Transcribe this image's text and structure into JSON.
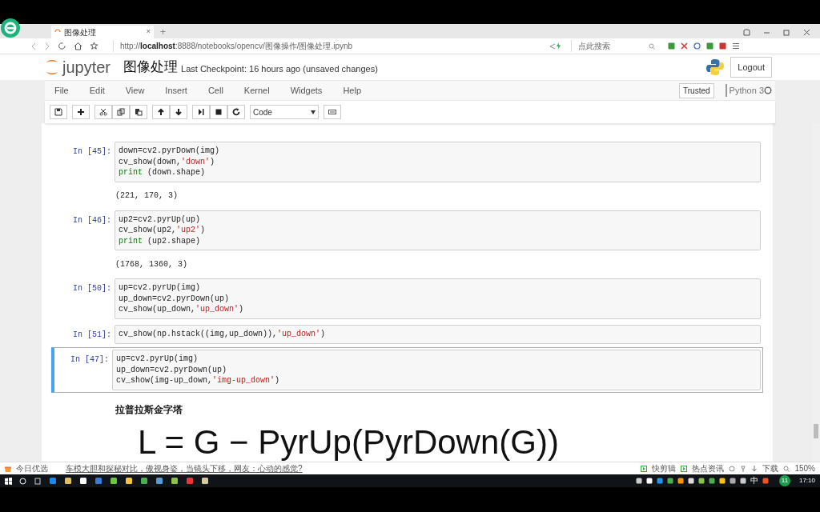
{
  "browser": {
    "tab_title": "图像处理",
    "tab_close": "×",
    "new_tab": "+",
    "url_prefix": "http://",
    "url_host": "localhost",
    "url_rest": ":8888/notebooks/opencv/图像操作/图像处理.ipynb",
    "search_placeholder": "点此搜索"
  },
  "jupyter": {
    "logo_text": "jupyter",
    "notebook_name": "图像处理",
    "checkpoint": "Last Checkpoint: 16 hours ago (unsaved changes)",
    "logout": "Logout",
    "menu": [
      "File",
      "Edit",
      "View",
      "Insert",
      "Cell",
      "Kernel",
      "Widgets",
      "Help"
    ],
    "trusted": "Trusted",
    "kernel": "Python 3",
    "cell_type": "Code"
  },
  "cells": [
    {
      "kind": "code",
      "prompt": "In [45]:",
      "selected": false,
      "lines": [
        [
          {
            "text": "down=cv2.pyrDown(img)",
            "kind": "plain"
          }
        ],
        [
          {
            "text": "cv_show(down,",
            "kind": "plain"
          },
          {
            "text": "'down'",
            "kind": "string"
          },
          {
            "text": ")",
            "kind": "plain"
          }
        ],
        [
          {
            "text": "print",
            "kind": "builtin"
          },
          {
            "text": " (down.shape)",
            "kind": "plain"
          }
        ]
      ]
    },
    {
      "kind": "output",
      "text": "(221, 170, 3)"
    },
    {
      "kind": "code",
      "prompt": "In [46]:",
      "selected": false,
      "lines": [
        [
          {
            "text": "up2=cv2.pyrUp(up)",
            "kind": "plain"
          }
        ],
        [
          {
            "text": "cv_show(up2,",
            "kind": "plain"
          },
          {
            "text": "'up2'",
            "kind": "string"
          },
          {
            "text": ")",
            "kind": "plain"
          }
        ],
        [
          {
            "text": "print",
            "kind": "builtin"
          },
          {
            "text": " (up2.shape)",
            "kind": "plain"
          }
        ]
      ]
    },
    {
      "kind": "output",
      "text": "(1768, 1360, 3)"
    },
    {
      "kind": "code",
      "prompt": "In [50]:",
      "selected": false,
      "lines": [
        [
          {
            "text": "up=cv2.pyrUp(img)",
            "kind": "plain"
          }
        ],
        [
          {
            "text": "up_down=cv2.pyrDown(up)",
            "kind": "plain"
          }
        ],
        [
          {
            "text": "cv_show(up_down,",
            "kind": "plain"
          },
          {
            "text": "'up_down'",
            "kind": "string"
          },
          {
            "text": ")",
            "kind": "plain"
          }
        ]
      ]
    },
    {
      "kind": "code",
      "prompt": "In [51]:",
      "selected": false,
      "lines": [
        [
          {
            "text": "cv_show(np.hstack((img,up_down)),",
            "kind": "plain"
          },
          {
            "text": "'up_down'",
            "kind": "string"
          },
          {
            "text": ")",
            "kind": "plain"
          }
        ]
      ]
    },
    {
      "kind": "code",
      "prompt": "In [47]:",
      "selected": true,
      "lines": [
        [
          {
            "text": "up=cv2.pyrUp(img)",
            "kind": "plain"
          }
        ],
        [
          {
            "text": "up_down=cv2.pyrDown(up)",
            "kind": "plain"
          }
        ],
        [
          {
            "text": "cv_show(img-up_down,",
            "kind": "plain"
          },
          {
            "text": "'img-up_down'",
            "kind": "string"
          },
          {
            "text": ")",
            "kind": "plain"
          }
        ]
      ]
    },
    {
      "kind": "heading",
      "text": "拉普拉斯金字塔"
    },
    {
      "kind": "formula",
      "text": "L = G − PyrUp(PyrDown(G))"
    }
  ],
  "status_bar": {
    "left_label": "今日优选",
    "news": "车模大胆和探秘对比，傲视身姿，当镜头下移，网友：心动的感觉?",
    "items": [
      "快剪辑",
      "热点资讯",
      "下载"
    ],
    "zoom": "150%"
  },
  "taskbar": {
    "ime": "中",
    "notify_count": "11",
    "clock": "17:10"
  }
}
